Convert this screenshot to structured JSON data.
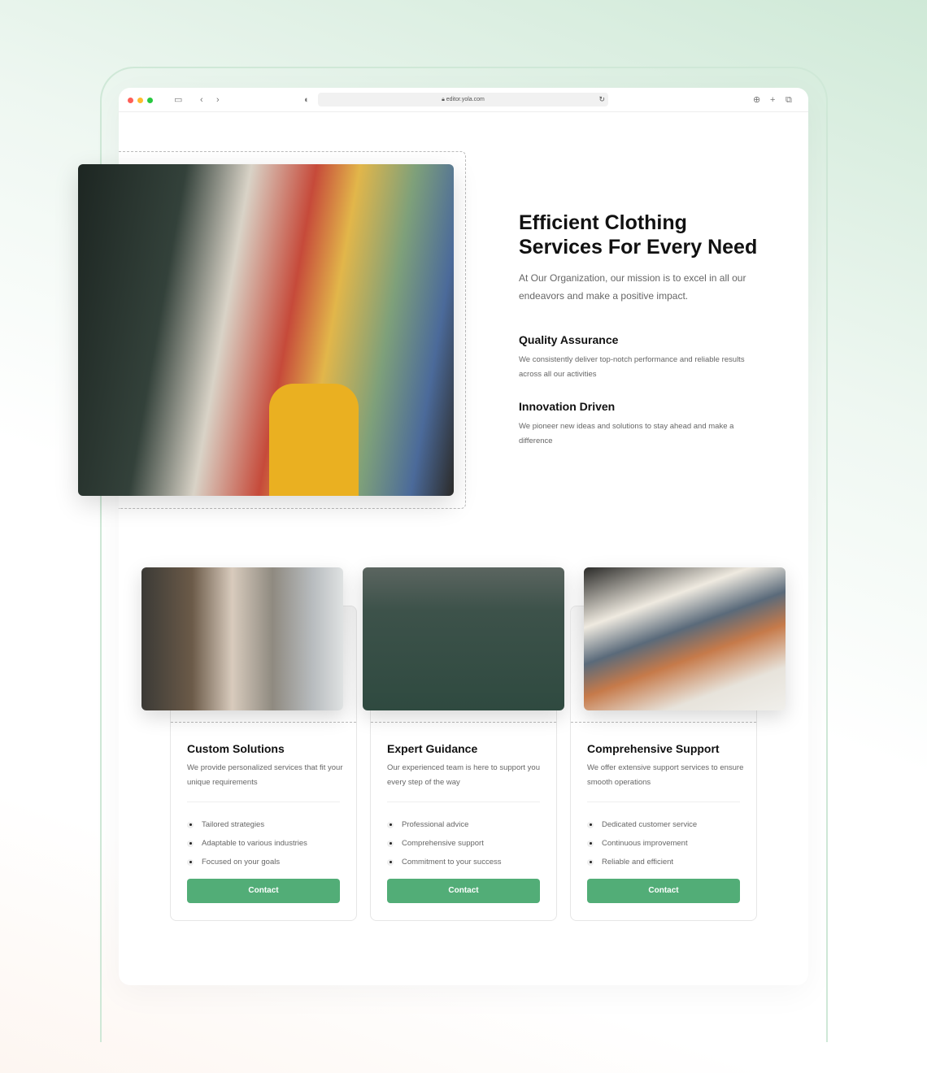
{
  "browser": {
    "url": "editor.yola.com",
    "colors": {
      "close": "#fe5f57",
      "min": "#febc2e",
      "max": "#28c840"
    }
  },
  "hero": {
    "title": "Efficient Clothing Services For Every Need",
    "lead": "At Our Organization, our mission is to excel in all our endeavors and make a positive impact.",
    "features": [
      {
        "title": "Quality Assurance",
        "text": "We consistently deliver top-notch performance and reliable results across all our activities"
      },
      {
        "title": "Innovation Driven",
        "text": "We pioneer new ideas and solutions to stay ahead and make a difference"
      }
    ]
  },
  "cards": [
    {
      "title": "Custom Solutions",
      "text": "We provide personalized services that fit your unique requirements",
      "items": [
        "Tailored strategies",
        "Adaptable to various industries",
        "Focused on your goals"
      ],
      "button": "Contact"
    },
    {
      "title": "Expert Guidance",
      "text": "Our experienced team is here to support you every step of the way",
      "items": [
        "Professional advice",
        "Comprehensive support",
        "Commitment to your success"
      ],
      "button": "Contact"
    },
    {
      "title": "Comprehensive Support",
      "text": "We offer extensive support services to ensure smooth operations",
      "items": [
        "Dedicated customer service",
        "Continuous improvement",
        "Reliable and efficient"
      ],
      "button": "Contact"
    }
  ],
  "accent": "#52ad77"
}
